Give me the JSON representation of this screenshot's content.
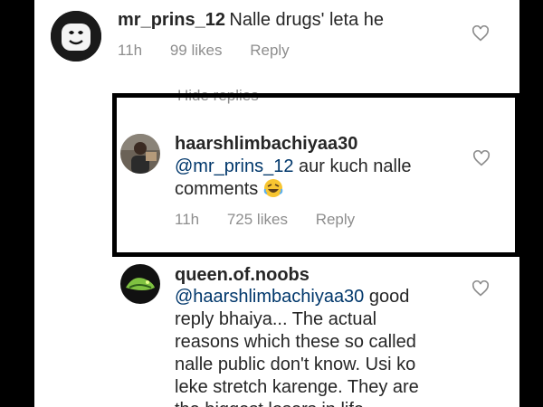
{
  "comments": [
    {
      "username": "mr_prins_12",
      "text": "Nalle drugs' leta he",
      "time": "11h",
      "likes": "99 likes",
      "reply_label": "Reply"
    },
    {
      "username": "haarshlimbachiyaa30",
      "mention": "@mr_prins_12",
      "text_line1": " aur kuch nalle",
      "text_line2": "comments",
      "time": "11h",
      "likes": "725 likes",
      "reply_label": "Reply"
    },
    {
      "username": "queen.of.noobs",
      "mention": "@haarshlimbachiyaa30",
      "text_line1": " good",
      "text_lines": [
        "reply bhaiya... The actual",
        "reasons which these so called",
        "nalle public don't know. Usi ko",
        "leke stretch karenge. They are",
        "the biggest losers in life"
      ]
    }
  ],
  "hide_replies_label": "Hide replies",
  "icons": {
    "heart": "heart-icon",
    "emoji": "rolling-on-floor-laughing-emoji"
  },
  "colors": {
    "username": "#262626",
    "mention": "#00376b",
    "meta": "#8e8e8e",
    "highlight_border": "#000000"
  }
}
